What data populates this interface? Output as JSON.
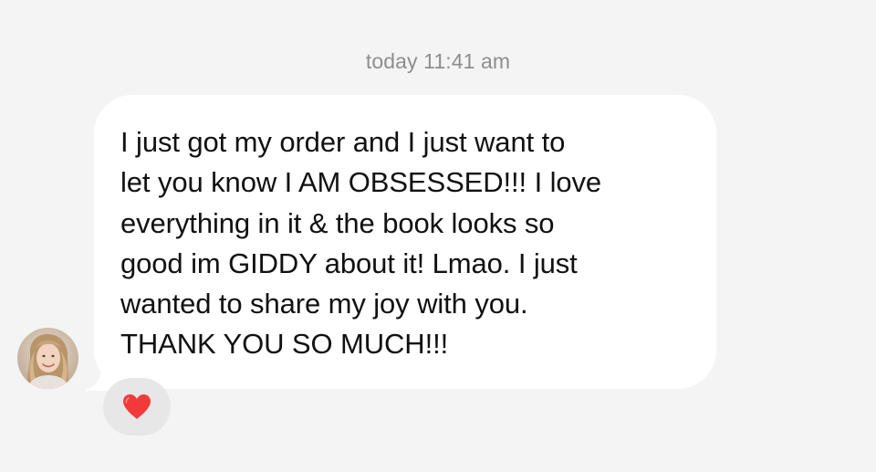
{
  "thread": {
    "timestamp": "today 11:41 am"
  },
  "message": {
    "sender_avatar_icon": "profile-photo",
    "text": "I just got my order and I just want to\nlet you know I AM OBSESSED!!! I love\neverything in it & the book looks so\ngood im GIDDY about it! Lmao. I just\nwanted to share my joy with you.\nTHANK YOU SO MUCH!!!",
    "reaction": {
      "icon": "red-heart",
      "color": "#f23a3a"
    }
  },
  "colors": {
    "background": "#f4f4f4",
    "bubble": "#ffffff",
    "timestamp_text": "#8e8e8e",
    "reaction_pill": "#e7e7e7"
  }
}
